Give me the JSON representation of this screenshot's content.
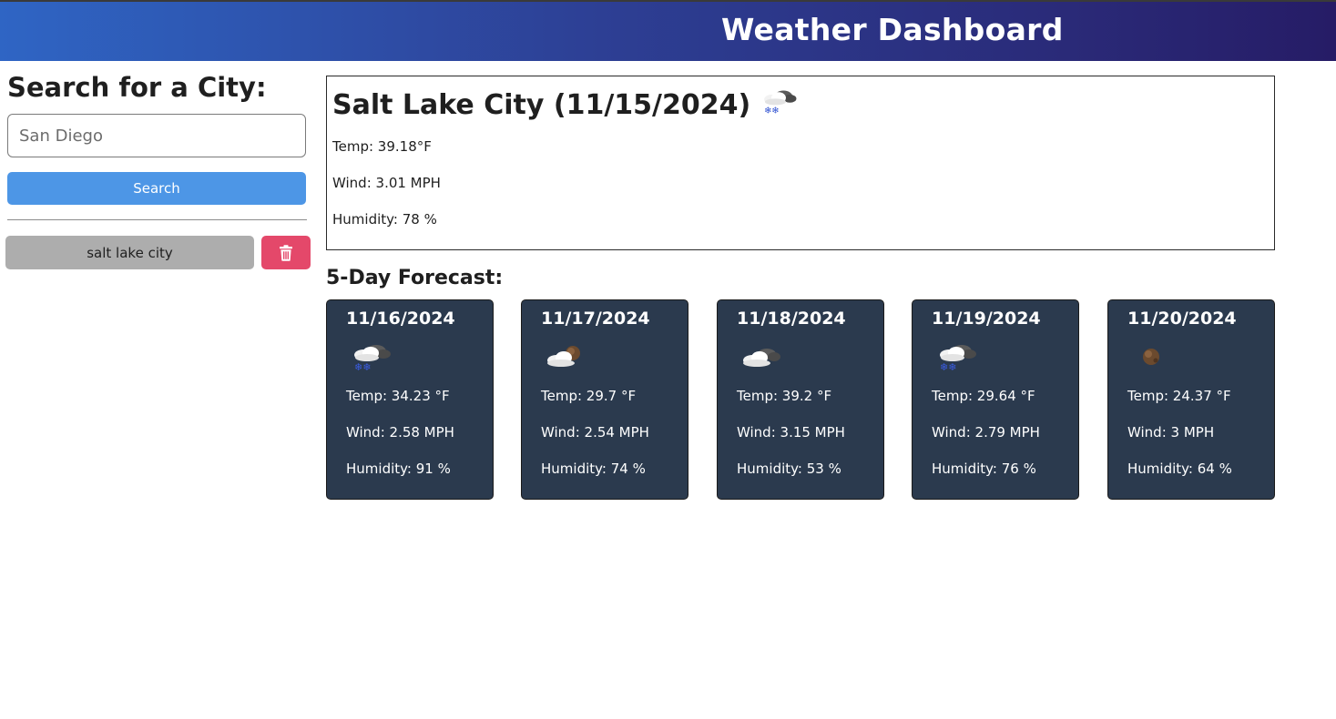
{
  "header": {
    "title": "Weather Dashboard"
  },
  "sidebar": {
    "heading": "Search for a City:",
    "search_placeholder": "San Diego",
    "search_value": "",
    "search_button_label": "Search",
    "history": [
      {
        "label": "salt lake city"
      }
    ],
    "delete_icon": "trash-icon"
  },
  "current": {
    "title": "Salt Lake City (11/15/2024)",
    "icon": "snow-cloud-icon",
    "temp": "Temp: 39.18°F",
    "wind": "Wind: 3.01 MPH",
    "humidity": "Humidity: 78 %"
  },
  "forecast": {
    "heading": "5-Day Forecast:",
    "days": [
      {
        "date": "11/16/2024",
        "icon": "snow-cloud-icon",
        "temp": "Temp: 34.23 °F",
        "wind": "Wind: 2.58 MPH",
        "humidity": "Humidity: 91 %"
      },
      {
        "date": "11/17/2024",
        "icon": "partly-cloudy-icon",
        "temp": "Temp: 29.7 °F",
        "wind": "Wind: 2.54 MPH",
        "humidity": "Humidity: 74 %"
      },
      {
        "date": "11/18/2024",
        "icon": "cloudy-icon",
        "temp": "Temp: 39.2 °F",
        "wind": "Wind: 3.15 MPH",
        "humidity": "Humidity: 53 %"
      },
      {
        "date": "11/19/2024",
        "icon": "snow-cloud-icon",
        "temp": "Temp: 29.64 °F",
        "wind": "Wind: 2.79 MPH",
        "humidity": "Humidity: 76 %"
      },
      {
        "date": "11/20/2024",
        "icon": "clear-icon",
        "temp": "Temp: 24.37 °F",
        "wind": "Wind: 3 MPH",
        "humidity": "Humidity: 64 %"
      }
    ]
  },
  "colors": {
    "header_gradient_start": "#2f65c4",
    "header_gradient_end": "#261c66",
    "search_button": "#4d96e6",
    "history_button": "#adadad",
    "delete_button": "#e4486a",
    "forecast_card": "#2b3a4e"
  }
}
